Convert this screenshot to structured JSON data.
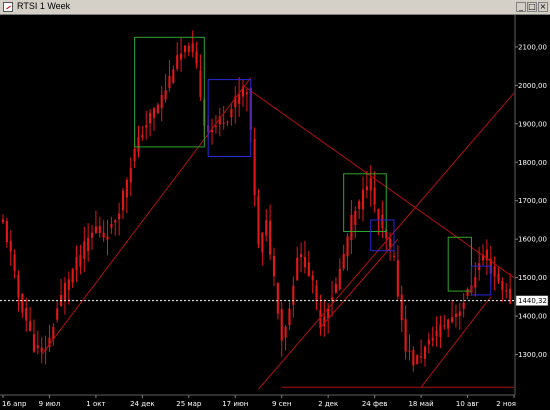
{
  "window": {
    "title": "RTSI 1 Week",
    "buttons": [
      "minimize-button",
      "maximize-button",
      "close-button"
    ]
  },
  "colors": {
    "background": "#000000",
    "candle": "#e01818",
    "trendline": "#b01010",
    "box_green": "#2fa52f",
    "box_blue": "#2a2ad8",
    "current_line": "#ffffff",
    "axis_text": "#ffffff"
  },
  "chart_data": {
    "type": "candlestick",
    "title": "RTSI 1 Week",
    "instrument": "RTSI",
    "timeframe": "1 Week",
    "ylim": [
      1200,
      2170
    ],
    "y_ticks": [
      "2100,00",
      "2000,00",
      "1900,00",
      "1800,00",
      "1700,00",
      "1600,00",
      "1500,00",
      "1400,00",
      "1300,00"
    ],
    "x_tick_labels": [
      "16 апр",
      "9 июл",
      "1 окт",
      "24 дек",
      "25 мар",
      "17 июн",
      "9 сен",
      "2 дек",
      "24 фев",
      "18 май",
      "10 авг",
      "2 ноя"
    ],
    "current_price": 1440.32,
    "current_price_label": "1440,32",
    "weeks": 132,
    "tick_week_index": [
      0,
      12,
      24,
      36,
      48,
      60,
      72,
      84,
      96,
      108,
      120,
      132
    ],
    "close_path": [
      {
        "w": 0,
        "c": 1640
      },
      {
        "w": 2,
        "c": 1560
      },
      {
        "w": 4,
        "c": 1450
      },
      {
        "w": 6,
        "c": 1390
      },
      {
        "w": 8,
        "c": 1320
      },
      {
        "w": 10,
        "c": 1300
      },
      {
        "w": 12,
        "c": 1340
      },
      {
        "w": 14,
        "c": 1420
      },
      {
        "w": 16,
        "c": 1480
      },
      {
        "w": 18,
        "c": 1520
      },
      {
        "w": 20,
        "c": 1560
      },
      {
        "w": 22,
        "c": 1600
      },
      {
        "w": 24,
        "c": 1630
      },
      {
        "w": 26,
        "c": 1610
      },
      {
        "w": 28,
        "c": 1630
      },
      {
        "w": 30,
        "c": 1680
      },
      {
        "w": 32,
        "c": 1760
      },
      {
        "w": 34,
        "c": 1830
      },
      {
        "w": 36,
        "c": 1880
      },
      {
        "w": 38,
        "c": 1920
      },
      {
        "w": 40,
        "c": 1950
      },
      {
        "w": 42,
        "c": 1990
      },
      {
        "w": 44,
        "c": 2050
      },
      {
        "w": 46,
        "c": 2080
      },
      {
        "w": 48,
        "c": 2100
      },
      {
        "w": 50,
        "c": 2050
      },
      {
        "w": 52,
        "c": 1900
      },
      {
        "w": 54,
        "c": 1880
      },
      {
        "w": 56,
        "c": 1910
      },
      {
        "w": 58,
        "c": 1920
      },
      {
        "w": 60,
        "c": 1960
      },
      {
        "w": 62,
        "c": 1990
      },
      {
        "w": 63,
        "c": 1980
      },
      {
        "w": 64,
        "c": 1870
      },
      {
        "w": 65,
        "c": 1720
      },
      {
        "w": 66,
        "c": 1580
      },
      {
        "w": 68,
        "c": 1640
      },
      {
        "w": 70,
        "c": 1500
      },
      {
        "w": 72,
        "c": 1340
      },
      {
        "w": 74,
        "c": 1420
      },
      {
        "w": 76,
        "c": 1560
      },
      {
        "w": 78,
        "c": 1540
      },
      {
        "w": 80,
        "c": 1480
      },
      {
        "w": 82,
        "c": 1380
      },
      {
        "w": 84,
        "c": 1430
      },
      {
        "w": 86,
        "c": 1480
      },
      {
        "w": 88,
        "c": 1560
      },
      {
        "w": 90,
        "c": 1650
      },
      {
        "w": 92,
        "c": 1690
      },
      {
        "w": 94,
        "c": 1750
      },
      {
        "w": 95,
        "c": 1740
      },
      {
        "w": 96,
        "c": 1680
      },
      {
        "w": 98,
        "c": 1620
      },
      {
        "w": 100,
        "c": 1570
      },
      {
        "w": 101,
        "c": 1540
      },
      {
        "w": 102,
        "c": 1460
      },
      {
        "w": 104,
        "c": 1320
      },
      {
        "w": 106,
        "c": 1280
      },
      {
        "w": 108,
        "c": 1300
      },
      {
        "w": 110,
        "c": 1330
      },
      {
        "w": 112,
        "c": 1360
      },
      {
        "w": 114,
        "c": 1380
      },
      {
        "w": 116,
        "c": 1400
      },
      {
        "w": 118,
        "c": 1420
      },
      {
        "w": 120,
        "c": 1460
      },
      {
        "w": 122,
        "c": 1510
      },
      {
        "w": 124,
        "c": 1560
      },
      {
        "w": 126,
        "c": 1520
      },
      {
        "w": 128,
        "c": 1490
      },
      {
        "w": 130,
        "c": 1460
      },
      {
        "w": 131,
        "c": 1440
      }
    ],
    "trendlines": [
      {
        "name": "support-1",
        "from": {
          "w": 10,
          "p": 1300
        },
        "to": {
          "w": 64,
          "p": 2020
        }
      },
      {
        "name": "resistance-1",
        "from": {
          "w": 62,
          "p": 2000
        },
        "to": {
          "w": 132,
          "p": 1500
        }
      },
      {
        "name": "support-2",
        "from": {
          "w": 82,
          "p": 1370
        },
        "to": {
          "w": 102,
          "p": 1600
        }
      },
      {
        "name": "long-trend",
        "from": {
          "w": 66,
          "p": 1210
        },
        "to": {
          "w": 132,
          "p": 1980
        }
      },
      {
        "name": "support-3",
        "from": {
          "w": 108,
          "p": 1215
        },
        "to": {
          "w": 126,
          "p": 1450
        }
      },
      {
        "name": "horizontal-base",
        "from": {
          "w": 72,
          "p": 1215
        },
        "to": {
          "w": 132,
          "p": 1215
        }
      }
    ],
    "boxes": [
      {
        "color": "green",
        "w1": 34,
        "w2": 52,
        "p_top": 2125,
        "p_bot": 1840
      },
      {
        "color": "blue",
        "w1": 53,
        "w2": 64,
        "p_top": 2015,
        "p_bot": 1815
      },
      {
        "color": "green",
        "w1": 88,
        "w2": 99,
        "p_top": 1770,
        "p_bot": 1620
      },
      {
        "color": "blue",
        "w1": 95,
        "w2": 101,
        "p_top": 1650,
        "p_bot": 1570
      },
      {
        "color": "green",
        "w1": 115,
        "w2": 121,
        "p_top": 1605,
        "p_bot": 1465
      },
      {
        "color": "blue",
        "w1": 121,
        "w2": 126,
        "p_top": 1530,
        "p_bot": 1455
      }
    ]
  }
}
